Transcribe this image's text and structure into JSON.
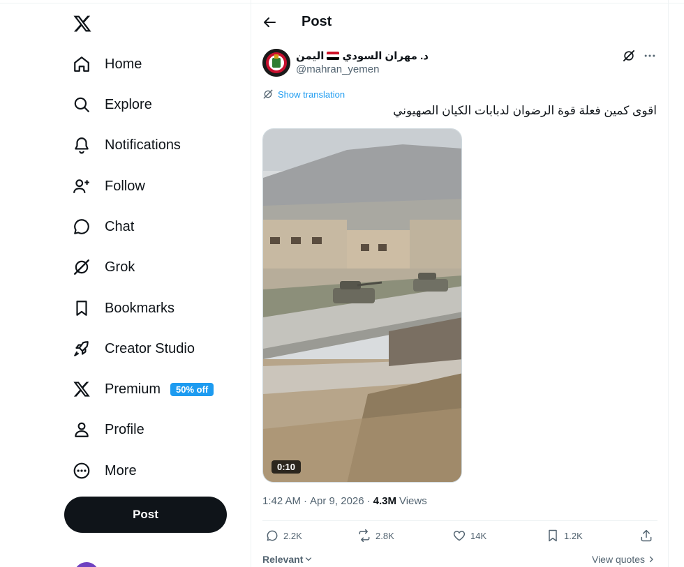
{
  "sidebar": {
    "nav": [
      {
        "label": "Home",
        "icon": "home-icon"
      },
      {
        "label": "Explore",
        "icon": "search-icon"
      },
      {
        "label": "Notifications",
        "icon": "bell-icon"
      },
      {
        "label": "Follow",
        "icon": "person-plus-icon"
      },
      {
        "label": "Chat",
        "icon": "chat-bubble-icon"
      },
      {
        "label": "Grok",
        "icon": "grok-icon"
      },
      {
        "label": "Bookmarks",
        "icon": "bookmark-icon"
      },
      {
        "label": "Creator Studio",
        "icon": "rocket-icon"
      },
      {
        "label": "Premium",
        "icon": "x-logo-icon",
        "badge": "50% off"
      },
      {
        "label": "Profile",
        "icon": "person-icon"
      },
      {
        "label": "More",
        "icon": "more-circle-icon"
      }
    ],
    "post_button": "Post"
  },
  "header": {
    "title": "Post"
  },
  "tweet": {
    "author_name": "د. مهران السودي",
    "author_suffix": "اليمن",
    "author_handle": "@mahran_yemen",
    "show_translation": "Show translation",
    "text": "اقوى كمين فعلة قوة الرضوان لدبابات الكيان الصهيوني",
    "video_duration": "0:10",
    "time": "1:42 AM",
    "date": "Apr 9, 2026",
    "views_count": "4.3M",
    "views_label": "Views",
    "replies": "2.2K",
    "reposts": "2.8K",
    "likes": "14K",
    "bookmarks": "1.2K"
  },
  "footer": {
    "sort_label": "Relevant",
    "view_quotes": "View quotes"
  },
  "colors": {
    "accent": "#1d9bf0",
    "text_primary": "#0f1419",
    "text_secondary": "#536471",
    "border": "#eff3f4",
    "post_button_bg": "#0f1419"
  }
}
